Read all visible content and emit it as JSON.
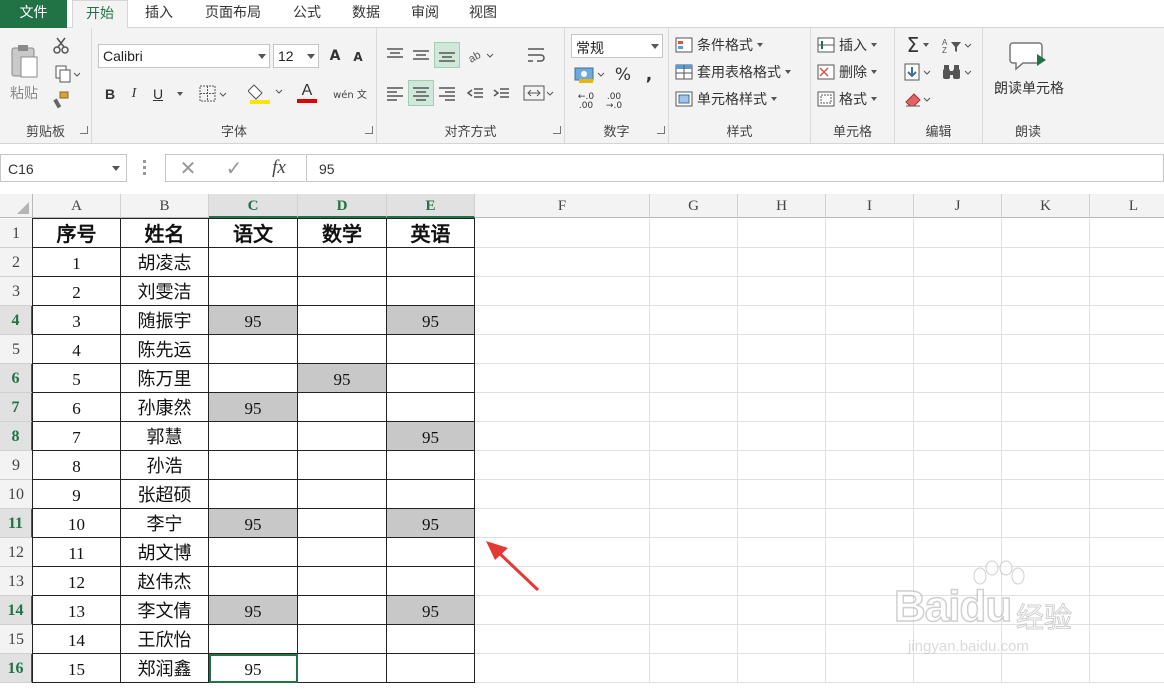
{
  "menu": {
    "file": "文件",
    "tabs": [
      "开始",
      "插入",
      "页面布局",
      "公式",
      "数据",
      "审阅",
      "视图"
    ]
  },
  "ribbon": {
    "clipboard": {
      "label": "剪贴板",
      "paste": "粘贴"
    },
    "font": {
      "label": "字体",
      "font_name": "Calibri",
      "font_size": "12",
      "bold": "B",
      "italic": "I",
      "underline": "U",
      "grow": "A",
      "shrink": "A",
      "font_color_letter": "A",
      "phonetic": "wén 文"
    },
    "alignment": {
      "label": "对齐方式"
    },
    "number": {
      "label": "数字",
      "format": "常规",
      "percent": "%",
      "comma": ",",
      "inc_decimal": "←.0 .00",
      "dec_decimal": ".00 →.0"
    },
    "styles": {
      "label": "样式",
      "conditional": "条件格式",
      "table_format": "套用表格格式",
      "cell_styles": "单元格样式"
    },
    "cells": {
      "label": "单元格",
      "insert": "插入",
      "delete": "删除",
      "format": "格式"
    },
    "editing": {
      "label": "编辑",
      "sum": "Σ"
    },
    "read": {
      "label": "朗读",
      "button": "朗读单元格"
    }
  },
  "formula_bar": {
    "name_box": "C16",
    "cancel": "✕",
    "enter": "✓",
    "fx": "fx",
    "value": "95"
  },
  "sheet": {
    "columns": [
      "A",
      "B",
      "C",
      "D",
      "E",
      "F",
      "G",
      "H",
      "I",
      "J",
      "K",
      "L"
    ],
    "rows": [
      "1",
      "2",
      "3",
      "4",
      "5",
      "6",
      "7",
      "8",
      "9",
      "10",
      "11",
      "12",
      "13",
      "14",
      "15",
      "16"
    ],
    "header": [
      "序号",
      "姓名",
      "语文",
      "数学",
      "英语"
    ],
    "data": [
      [
        "1",
        "胡凌志",
        "",
        "",
        ""
      ],
      [
        "2",
        "刘雯洁",
        "",
        "",
        ""
      ],
      [
        "3",
        "随振宇",
        "95",
        "",
        "95"
      ],
      [
        "4",
        "陈先运",
        "",
        "",
        ""
      ],
      [
        "5",
        "陈万里",
        "",
        "95",
        ""
      ],
      [
        "6",
        "孙康然",
        "95",
        "",
        ""
      ],
      [
        "7",
        "郭慧",
        "",
        "",
        "95"
      ],
      [
        "8",
        "孙浩",
        "",
        "",
        ""
      ],
      [
        "9",
        "张超硕",
        "",
        "",
        ""
      ],
      [
        "10",
        "李宁",
        "95",
        "",
        "95"
      ],
      [
        "11",
        "胡文博",
        "",
        "",
        ""
      ],
      [
        "12",
        "赵伟杰",
        "",
        "",
        ""
      ],
      [
        "13",
        "李文倩",
        "95",
        "",
        "95"
      ],
      [
        "14",
        "王欣怡",
        "",
        "",
        ""
      ],
      [
        "15",
        "郑润鑫",
        "95",
        "",
        ""
      ]
    ],
    "highlight_color": "#c8c8c8",
    "accent_color": "#217346",
    "annotation_arrow_color": "#e53935"
  },
  "watermark": {
    "brand": "Baidu",
    "cn": "经验",
    "url": "jingyan.baidu.com"
  }
}
